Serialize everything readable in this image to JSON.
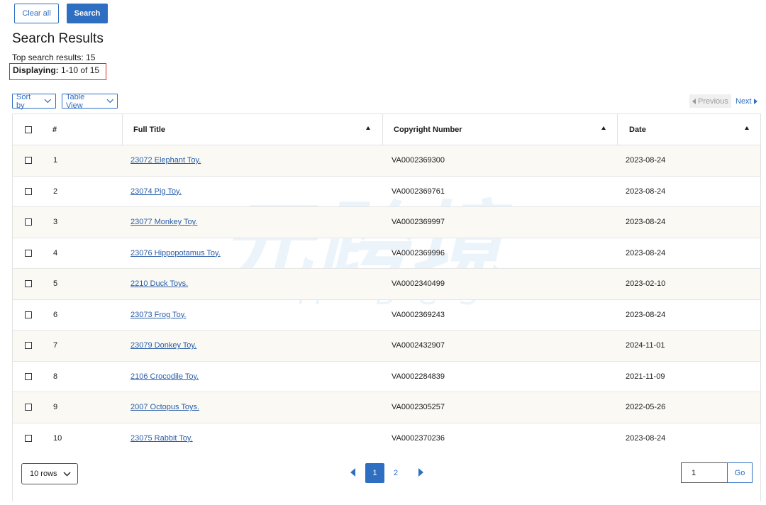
{
  "toolbar": {
    "clear_label": "Clear all",
    "search_label": "Search"
  },
  "results": {
    "heading": "Search Results",
    "top_results": "Top search results: 15",
    "displaying_label": "Displaying:",
    "displaying_value": " 1-10 of 15"
  },
  "controls": {
    "sort_label": "Sort by",
    "view_label": "Table View",
    "prev_label": "Previous",
    "next_label": "Next"
  },
  "table": {
    "headers": {
      "num": "#",
      "title": "Full Title",
      "copyright": "Copyright Number",
      "date": "Date"
    },
    "rows": [
      {
        "num": "1",
        "title": "23072 Elephant Toy.",
        "copyright": "VA0002369300",
        "date": "2023-08-24"
      },
      {
        "num": "2",
        "title": "23074 Pig Toy.",
        "copyright": "VA0002369761",
        "date": "2023-08-24"
      },
      {
        "num": "3",
        "title": "23077 Monkey Toy.",
        "copyright": "VA0002369997",
        "date": "2023-08-24"
      },
      {
        "num": "4",
        "title": "23076 Hippopotamus Toy.",
        "copyright": "VA0002369996",
        "date": "2023-08-24"
      },
      {
        "num": "5",
        "title": "2210 Duck Toys.",
        "copyright": "VA0002340499",
        "date": "2023-02-10"
      },
      {
        "num": "6",
        "title": "23073 Frog Toy.",
        "copyright": "VA0002369243",
        "date": "2023-08-24"
      },
      {
        "num": "7",
        "title": "23079 Donkey Toy.",
        "copyright": "VA0002432907",
        "date": "2024-11-01"
      },
      {
        "num": "8",
        "title": "2106 Crocodile Toy.",
        "copyright": "VA0002284839",
        "date": "2021-11-09"
      },
      {
        "num": "9",
        "title": "2007 Octopus Toys.",
        "copyright": "VA0002305257",
        "date": "2022-05-26"
      },
      {
        "num": "10",
        "title": "23075 Rabbit Toy.",
        "copyright": "VA0002370236",
        "date": "2023-08-24"
      }
    ]
  },
  "footer": {
    "rows_per_page": "10 rows",
    "page_1": "1",
    "page_2": "2",
    "page_input_value": "1",
    "go_label": "Go"
  },
  "watermark": {
    "main": "元跨境",
    "sub": "M·BCS"
  },
  "colors": {
    "accent": "#2e6fc2",
    "highlight_border": "#e0251b",
    "row_alt": "#faf9f4"
  }
}
